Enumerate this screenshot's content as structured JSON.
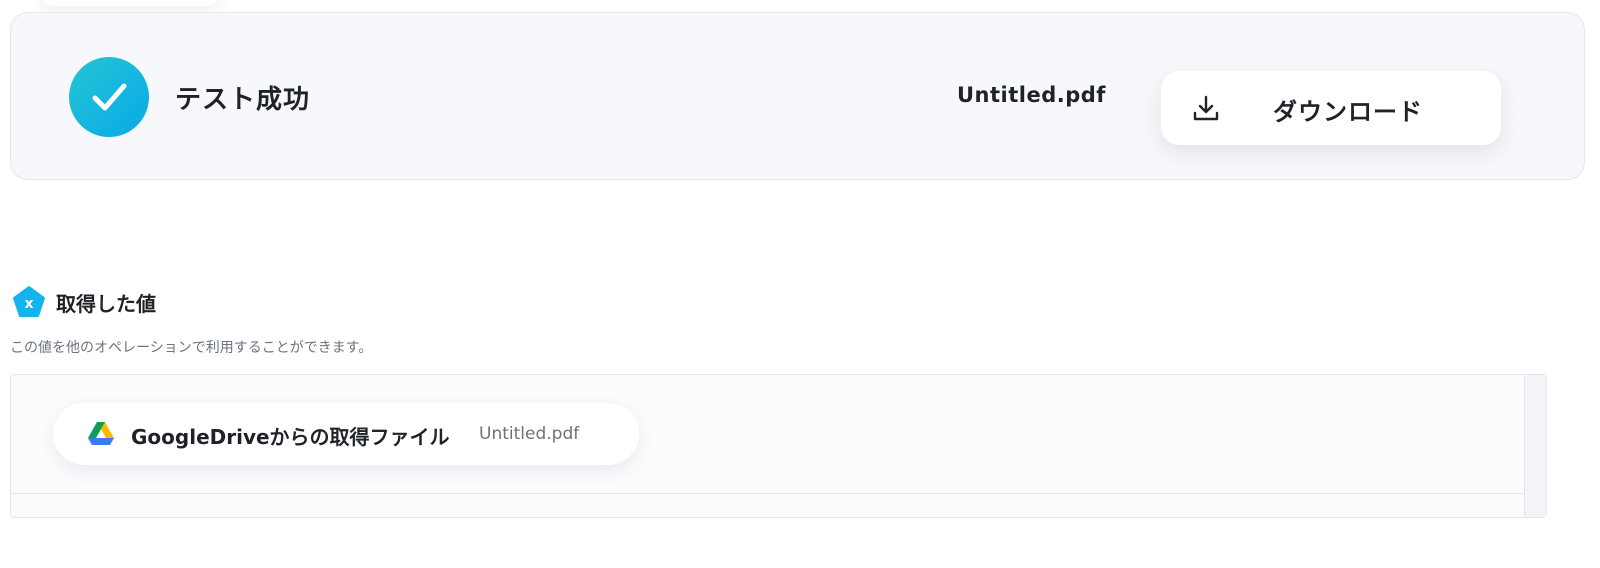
{
  "result": {
    "status_label": "テスト成功",
    "file_name": "Untitled.pdf",
    "download_label": "ダウンロード",
    "success_color": "#07a9ea"
  },
  "section": {
    "icon": "variable-x-icon",
    "title": "取得した値",
    "description": "この値を他のオペレーションで利用することができます。"
  },
  "values": [
    {
      "icon": "google-drive-icon",
      "label": "GoogleDriveからの取得ファイル",
      "value": "Untitled.pdf"
    }
  ]
}
